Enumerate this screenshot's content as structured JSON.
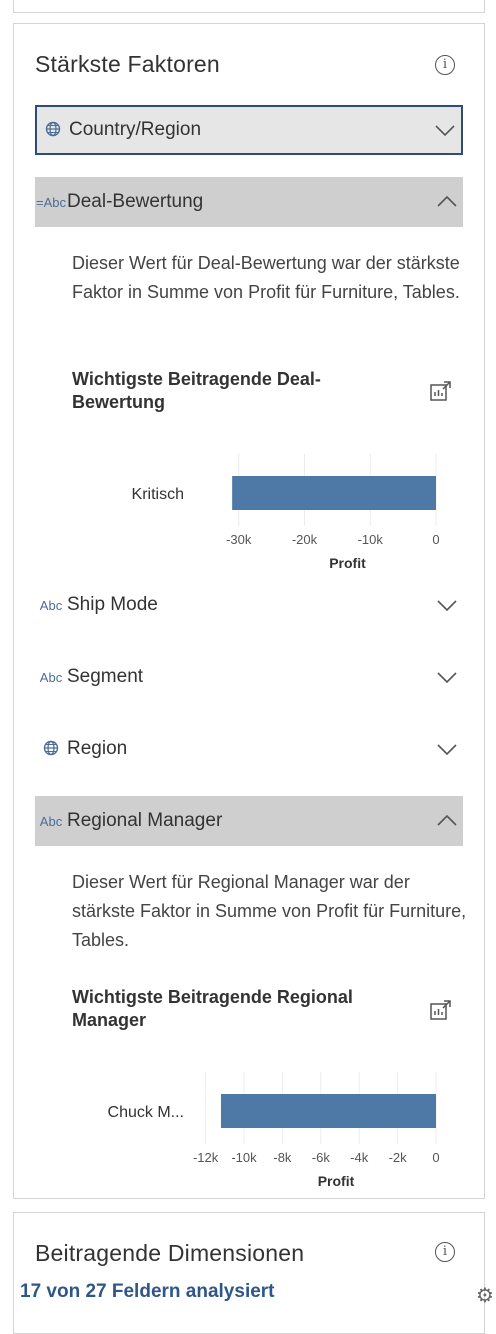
{
  "card": {
    "title": "Stärkste Faktoren",
    "info_glyph": "i"
  },
  "rows": {
    "country": {
      "label": "Country/Region",
      "icon": "globe-icon"
    },
    "deal": {
      "label": "Deal-Bewertung",
      "icon_text": "=Abc"
    },
    "shipmode": {
      "label": "Ship Mode",
      "icon_text": "Abc"
    },
    "segment": {
      "label": "Segment",
      "icon_text": "Abc"
    },
    "region": {
      "label": "Region",
      "icon": "globe-icon"
    },
    "manager": {
      "label": "Regional Manager",
      "icon_text": "Abc"
    }
  },
  "deal_section": {
    "description": "Dieser Wert für Deal-Bewertung war der stärkste Faktor in Summe von Profit für Furniture, Tables.",
    "subheading": "Wichtigste Beitragende Deal-Bewertung"
  },
  "manager_section": {
    "description": "Dieser Wert für Regional Manager war der stärkste Faktor in Summe von Profit für Furniture, Tables.",
    "subheading": "Wichtigste Beitragende Regional Manager"
  },
  "chart_data": [
    {
      "type": "bar",
      "orientation": "horizontal",
      "categories": [
        "Kritisch"
      ],
      "values": [
        -31000
      ],
      "xlabel": "Profit",
      "xlim": [
        -33000,
        0
      ],
      "ticks": [
        -30000,
        -20000,
        -10000,
        0
      ],
      "tick_labels": [
        "-30k",
        "-20k",
        "-10k",
        "0"
      ],
      "color": "#4e79a7"
    },
    {
      "type": "bar",
      "orientation": "horizontal",
      "categories": [
        "Chuck M..."
      ],
      "values": [
        -11200
      ],
      "xlabel": "Profit",
      "xlim": [
        -12500,
        0
      ],
      "ticks": [
        -12000,
        -10000,
        -8000,
        -6000,
        -4000,
        -2000,
        0
      ],
      "tick_labels": [
        "-12k",
        "-10k",
        "-8k",
        "-6k",
        "-4k",
        "-2k",
        "0"
      ],
      "color": "#4e79a7"
    }
  ],
  "card2": {
    "title": "Beitragende Dimensionen",
    "info_glyph": "i"
  },
  "footer": {
    "status": "17 von 27 Feldern analysiert",
    "icon": "gear-icon"
  },
  "colors": {
    "accent": "#2f5687",
    "selected_border": "#2f4c74",
    "bar": "#4e79a7"
  }
}
